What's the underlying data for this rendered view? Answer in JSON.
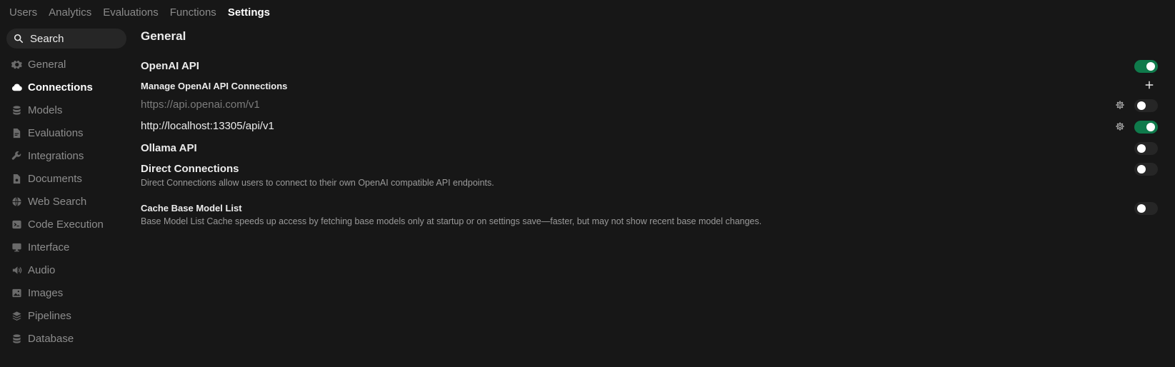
{
  "topnav": {
    "tabs": [
      {
        "label": "Users"
      },
      {
        "label": "Analytics"
      },
      {
        "label": "Evaluations"
      },
      {
        "label": "Functions"
      },
      {
        "label": "Settings"
      }
    ]
  },
  "sidebar": {
    "search_label": "Search",
    "items": [
      {
        "label": "General",
        "icon": "gear-icon"
      },
      {
        "label": "Connections",
        "icon": "cloud-icon"
      },
      {
        "label": "Models",
        "icon": "database-icon"
      },
      {
        "label": "Evaluations",
        "icon": "document-icon"
      },
      {
        "label": "Integrations",
        "icon": "wrench-icon"
      },
      {
        "label": "Documents",
        "icon": "file-icon"
      },
      {
        "label": "Web Search",
        "icon": "globe-icon"
      },
      {
        "label": "Code Execution",
        "icon": "terminal-icon"
      },
      {
        "label": "Interface",
        "icon": "monitor-icon"
      },
      {
        "label": "Audio",
        "icon": "speaker-icon"
      },
      {
        "label": "Images",
        "icon": "image-icon"
      },
      {
        "label": "Pipelines",
        "icon": "layers-icon"
      },
      {
        "label": "Database",
        "icon": "database-icon"
      }
    ]
  },
  "main": {
    "title": "General",
    "openai_api": {
      "label": "OpenAI API",
      "enabled": true
    },
    "manage_openai": {
      "label": "Manage OpenAI API Connections"
    },
    "connections": [
      {
        "url": "https://api.openai.com/v1",
        "enabled": false
      },
      {
        "url": "http://localhost:13305/api/v1",
        "enabled": true
      }
    ],
    "ollama_api": {
      "label": "Ollama API",
      "enabled": false
    },
    "direct_connections": {
      "label": "Direct Connections",
      "description": "Direct Connections allow users to connect to their own OpenAI compatible API endpoints.",
      "enabled": false
    },
    "cache_base_model": {
      "label": "Cache Base Model List",
      "description": "Base Model List Cache speeds up access by fetching base models only at startup or on settings save—faster, but may not show recent base model changes.",
      "enabled": false
    }
  },
  "colors": {
    "background": "#171717",
    "toggle_on": "#0f7a4b",
    "toggle_off": "#262626",
    "search_bg": "#262626"
  }
}
